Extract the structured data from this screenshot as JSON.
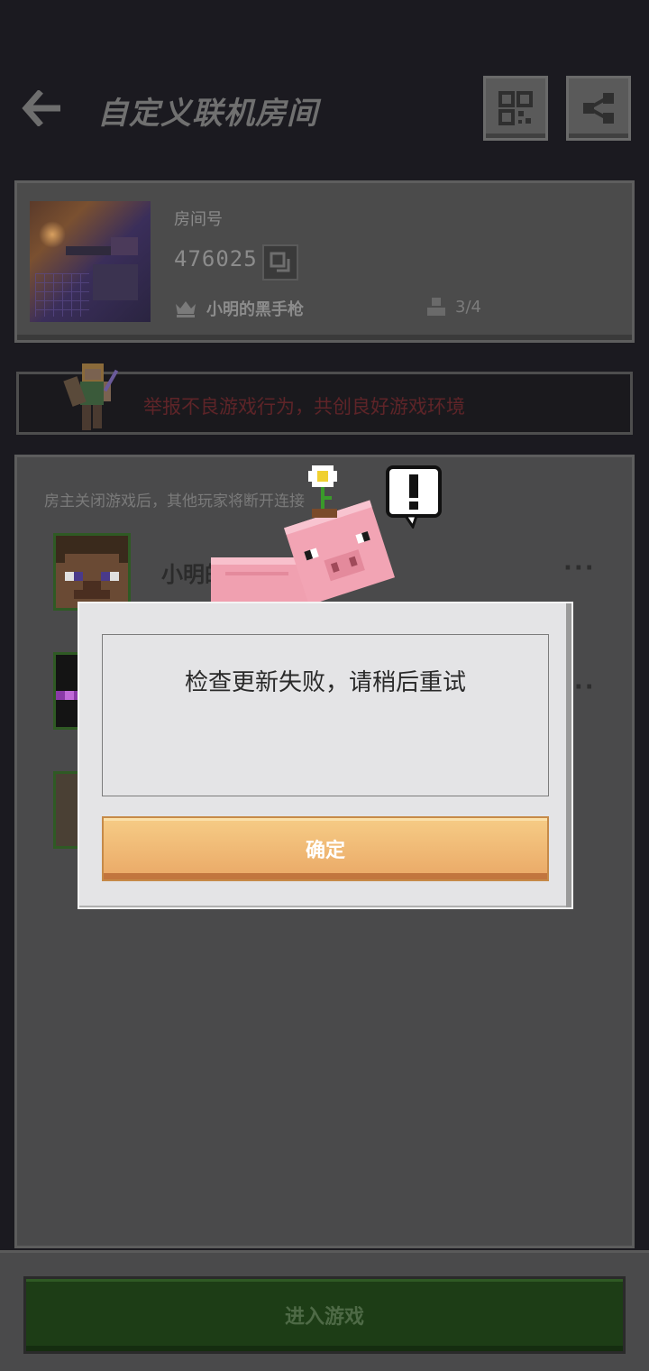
{
  "header": {
    "title": "自定义联机房间"
  },
  "room": {
    "label": "房间号",
    "number": "476025",
    "host_name": "小明的黑手枪",
    "player_count": "3/4"
  },
  "report": {
    "text": "举报不良游戏行为，共创良好游戏环境"
  },
  "panel": {
    "note": "房主关闭游戏后，其他玩家将断开连接",
    "players": [
      {
        "name": "小明的黑手枪",
        "more": "···"
      },
      {
        "name": "",
        "more": "···"
      },
      {
        "name": "",
        "more": ""
      }
    ]
  },
  "bottom": {
    "enter_label": "进入游戏"
  },
  "dialog": {
    "message": "检查更新失败，请稍后重试",
    "ok_label": "确定"
  },
  "colors": {
    "accent_orange": "#eaa866",
    "enter_green": "#1d3d16",
    "report_red": "#5e2428"
  }
}
